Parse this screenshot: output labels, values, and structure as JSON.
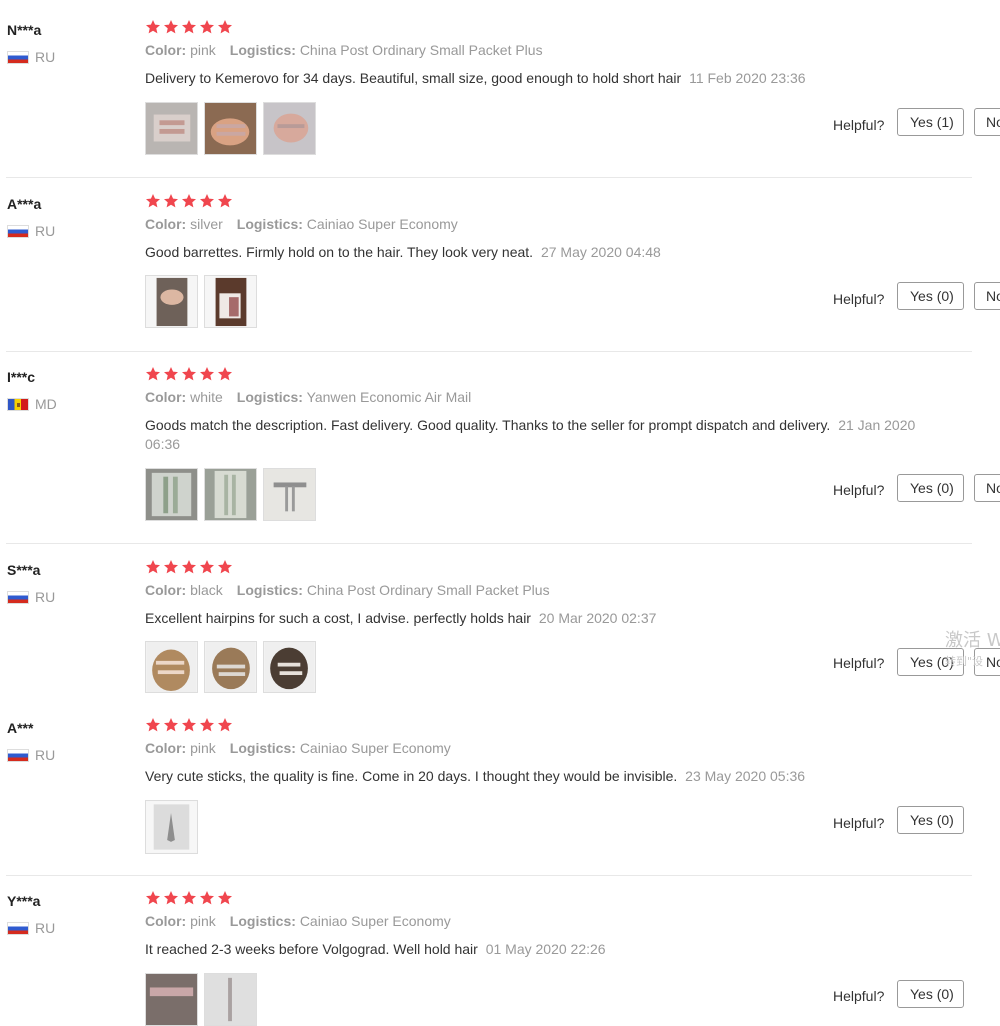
{
  "helpful_label": "Helpful?",
  "no_label": "No",
  "watermark": {
    "line1": "激活 W",
    "line2": "转到\"设"
  },
  "reviews": [
    {
      "user": "N***a",
      "country": "RU",
      "color_label": "Color:",
      "color": "pink",
      "logistics_label": "Logistics:",
      "logistics": "China Post Ordinary Small Packet Plus",
      "text": "Delivery to Kemerovo for 34 days. Beautiful, small size, good enough to hold short hair",
      "date": "11 Feb 2020 23:36",
      "yes": "Yes (1)",
      "rating": 5
    },
    {
      "user": "A***a",
      "country": "RU",
      "color_label": "Color:",
      "color": "silver",
      "logistics_label": "Logistics:",
      "logistics": "Cainiao Super Economy",
      "text": "Good barrettes. Firmly hold on to the hair. They look very neat.",
      "date": "27 May 2020 04:48",
      "yes": "Yes (0)",
      "rating": 5
    },
    {
      "user": "I***c",
      "country": "MD",
      "color_label": "Color:",
      "color": "white",
      "logistics_label": "Logistics:",
      "logistics": "Yanwen Economic Air Mail",
      "text": "Goods match the description. Fast delivery. Good quality. Thanks to the seller for prompt dispatch and delivery.",
      "date": "21 Jan 2020 06:36",
      "yes": "Yes (0)",
      "rating": 5
    },
    {
      "user": "S***a",
      "country": "RU",
      "color_label": "Color:",
      "color": "black",
      "logistics_label": "Logistics:",
      "logistics": "China Post Ordinary Small Packet Plus",
      "text": "Excellent hairpins for such a cost, I advise. perfectly holds hair",
      "date": "20 Mar 2020 02:37",
      "yes": "Yes (0)",
      "rating": 5
    },
    {
      "user": "A***",
      "country": "RU",
      "color_label": "Color:",
      "color": "pink",
      "logistics_label": "Logistics:",
      "logistics": "Cainiao Super Economy",
      "text": "Very cute sticks, the quality is fine. Come in 20 days. I thought they would be invisible.",
      "date": "23 May 2020 05:36",
      "yes": "Yes (0)",
      "rating": 5
    },
    {
      "user": "Y***a",
      "country": "RU",
      "color_label": "Color:",
      "color": "pink",
      "logistics_label": "Logistics:",
      "logistics": "Cainiao Super Economy",
      "text": "It reached 2-3 weeks before Volgograd. Well hold hair",
      "date": "01 May 2020 22:26",
      "yes": "Yes (0)",
      "rating": 5
    }
  ],
  "colors": {
    "star": "#f0464e",
    "muted": "#999999",
    "border": "#999999"
  }
}
